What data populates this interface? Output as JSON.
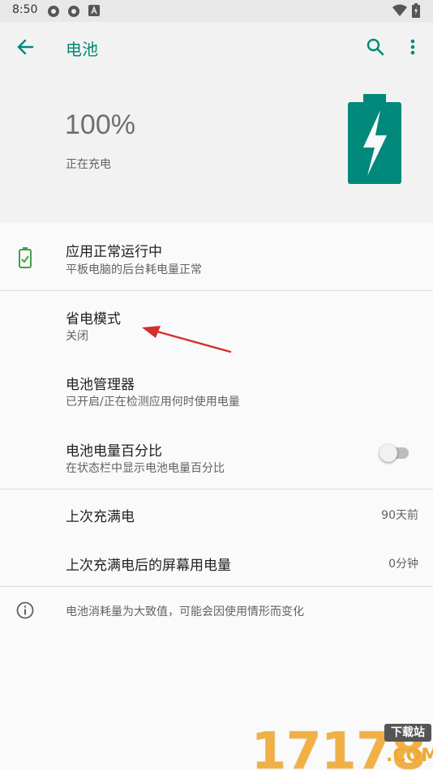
{
  "status_bar": {
    "time": "8:50",
    "icons": [
      "gear-icon",
      "gear-icon",
      "notification-a-icon",
      "wifi-icon",
      "battery-charging-icon"
    ]
  },
  "app_bar": {
    "title": "电池",
    "icons": [
      "back-arrow-icon",
      "search-icon",
      "more-vert-icon"
    ]
  },
  "header": {
    "level": "100%",
    "status": "正在充电"
  },
  "items": {
    "app_status": {
      "title": "应用正常运行中",
      "subtitle": "平板电脑的后台耗电量正常"
    },
    "battery_saver": {
      "title": "省电模式",
      "subtitle": "关闭"
    },
    "battery_manager": {
      "title": "电池管理器",
      "subtitle": "已开启/正在检测应用何时使用电量"
    },
    "battery_percent": {
      "title": "电池电量百分比",
      "subtitle": "在状态栏中显示电池电量百分比",
      "enabled": false
    },
    "last_full_charge": {
      "title": "上次充满电",
      "value": "90天前"
    },
    "screen_usage": {
      "title": "上次充满电后的屏幕用电量",
      "value": "0分钟"
    }
  },
  "footer_note": "电池消耗量为大致值，可能会因使用情形而变化",
  "watermark": {
    "main": "17178",
    "badge": "下载站",
    "domain": ".COM"
  },
  "colors": {
    "accent": "#00897b",
    "annotation_arrow": "#d32f2f",
    "watermark": "#f0a830"
  }
}
